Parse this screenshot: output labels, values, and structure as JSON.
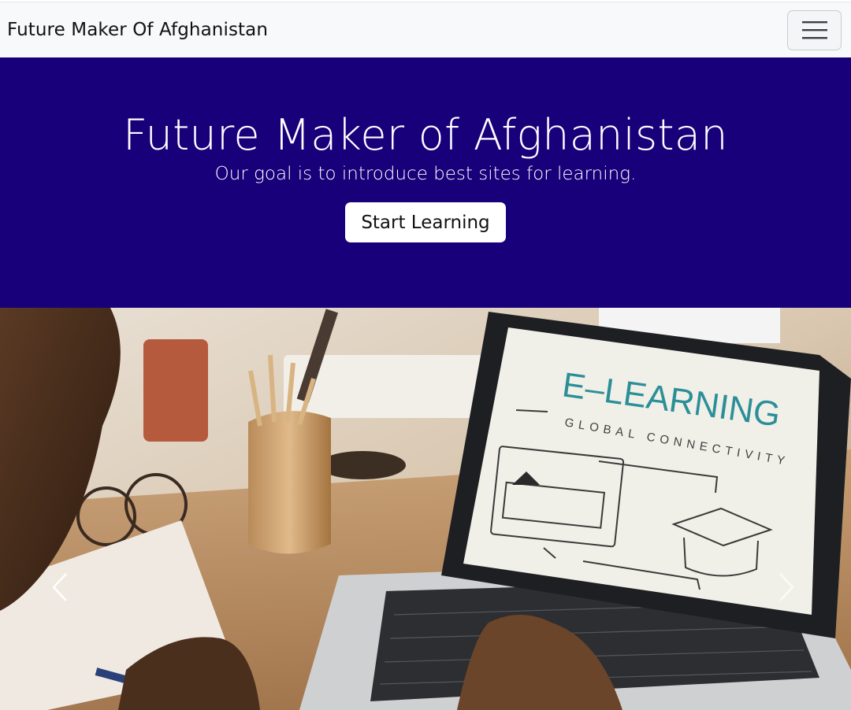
{
  "navbar": {
    "brand": "Future Maker Of Afghanistan",
    "toggler_icon": "hamburger-icon"
  },
  "hero": {
    "title": "Future Maker of Afghanistan",
    "subtitle": "Our goal is to introduce best sites for learning.",
    "cta_label": "Start Learning",
    "background_color": "#18007a"
  },
  "carousel": {
    "screen_title": "E–LEARNING",
    "screen_subtitle": "GLOBAL CONNECTIVITY",
    "prev_icon": "chevron-left-icon",
    "next_icon": "chevron-right-icon"
  }
}
